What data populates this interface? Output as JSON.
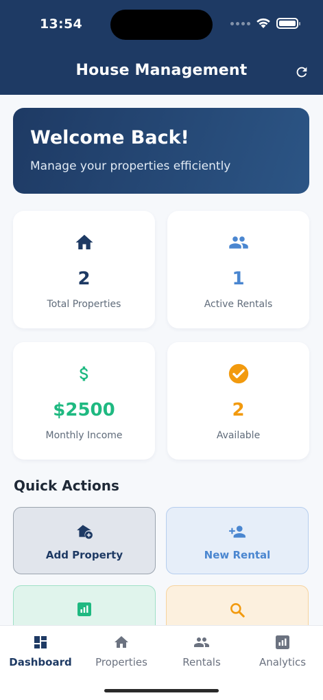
{
  "status_bar": {
    "time": "13:54"
  },
  "header": {
    "title": "House Management"
  },
  "welcome": {
    "title": "Welcome Back!",
    "subtitle": "Manage your properties efficiently"
  },
  "stats": [
    {
      "value": "2",
      "label": "Total Properties",
      "color": "#1e3a64",
      "icon": "home-icon"
    },
    {
      "value": "1",
      "label": "Active Rentals",
      "color": "#4a86d0",
      "icon": "people-icon"
    },
    {
      "value": "$2500",
      "label": "Monthly Income",
      "color": "#1fb981",
      "icon": "dollar-icon"
    },
    {
      "value": "2",
      "label": "Available",
      "color": "#f29a0e",
      "icon": "check-circle-icon"
    }
  ],
  "quick_actions": {
    "title": "Quick Actions",
    "items": [
      {
        "label": "Add Property",
        "icon": "add-home-icon",
        "color": "#1e3a64"
      },
      {
        "label": "New Rental",
        "icon": "person-add-icon",
        "color": "#4a86d0"
      },
      {
        "label": "",
        "icon": "chart-icon",
        "color": "#1fb981"
      },
      {
        "label": "",
        "icon": "search-icon",
        "color": "#f29a0e"
      }
    ]
  },
  "bottom_nav": [
    {
      "label": "Dashboard",
      "icon": "dashboard-icon",
      "active": true
    },
    {
      "label": "Properties",
      "icon": "home-icon",
      "active": false
    },
    {
      "label": "Rentals",
      "icon": "people-icon",
      "active": false
    },
    {
      "label": "Analytics",
      "icon": "analytics-icon",
      "active": false
    }
  ]
}
